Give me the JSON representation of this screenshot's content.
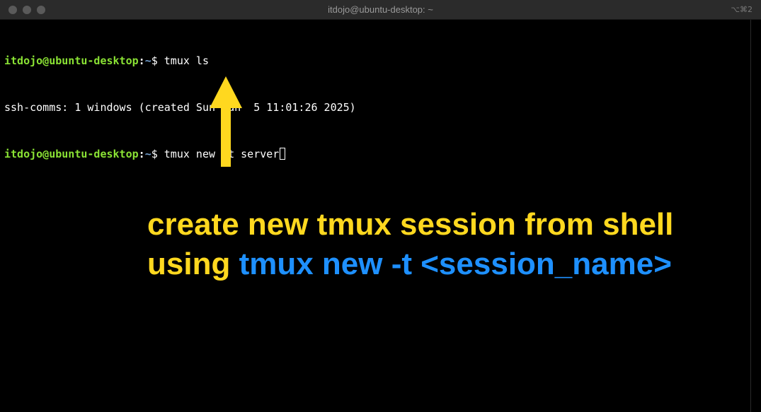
{
  "window": {
    "title": "itdojo@ubuntu-desktop: ~",
    "shortcut": "⌥⌘2"
  },
  "terminal": {
    "lines": [
      {
        "user_host": "itdojo@ubuntu-desktop",
        "colon": ":",
        "path": "~",
        "dollar": "$ ",
        "command": "tmux ls"
      },
      {
        "output": "ssh-comms: 1 windows (created Sun Jan  5 11:01:26 2025)"
      },
      {
        "user_host": "itdojo@ubuntu-desktop",
        "colon": ":",
        "path": "~",
        "dollar": "$ ",
        "command": "tmux new -t server"
      }
    ]
  },
  "annotation": {
    "line1": "create new tmux session from shell",
    "line2_prefix": "using ",
    "line2_command": "tmux new -t <session_name>",
    "colors": {
      "yellow": "#ffd81f",
      "blue": "#1e90ff",
      "arrow": "#ffd81f"
    }
  }
}
